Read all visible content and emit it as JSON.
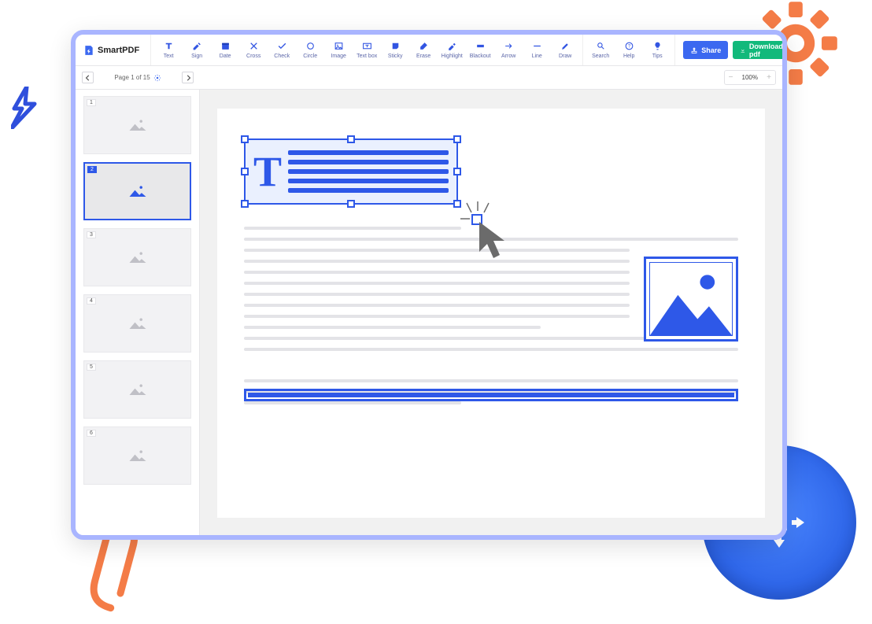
{
  "app": {
    "name": "SmartPDF"
  },
  "toolbar": {
    "tools": [
      {
        "id": "text",
        "label": "Text"
      },
      {
        "id": "sign",
        "label": "Sign"
      },
      {
        "id": "date",
        "label": "Date"
      },
      {
        "id": "cross",
        "label": "Cross"
      },
      {
        "id": "check",
        "label": "Check"
      },
      {
        "id": "circle",
        "label": "Circle"
      },
      {
        "id": "image",
        "label": "Image"
      },
      {
        "id": "textbox",
        "label": "Text box"
      },
      {
        "id": "sticky",
        "label": "Sticky"
      },
      {
        "id": "erase",
        "label": "Erase"
      },
      {
        "id": "highlight",
        "label": "Highlight"
      },
      {
        "id": "blackout",
        "label": "Blackout"
      },
      {
        "id": "arrow",
        "label": "Arrow"
      },
      {
        "id": "line",
        "label": "Line"
      },
      {
        "id": "draw",
        "label": "Draw"
      }
    ],
    "utilities": [
      {
        "id": "search",
        "label": "Search"
      },
      {
        "id": "help",
        "label": "Help"
      },
      {
        "id": "tips",
        "label": "Tips"
      }
    ],
    "share": "Share",
    "download": "Download pdf"
  },
  "pager": {
    "label": "Page 1 of 15",
    "current": 1,
    "total": 15
  },
  "zoom": {
    "value": "100%"
  },
  "thumbnails": {
    "count": 6,
    "selected": 2
  }
}
